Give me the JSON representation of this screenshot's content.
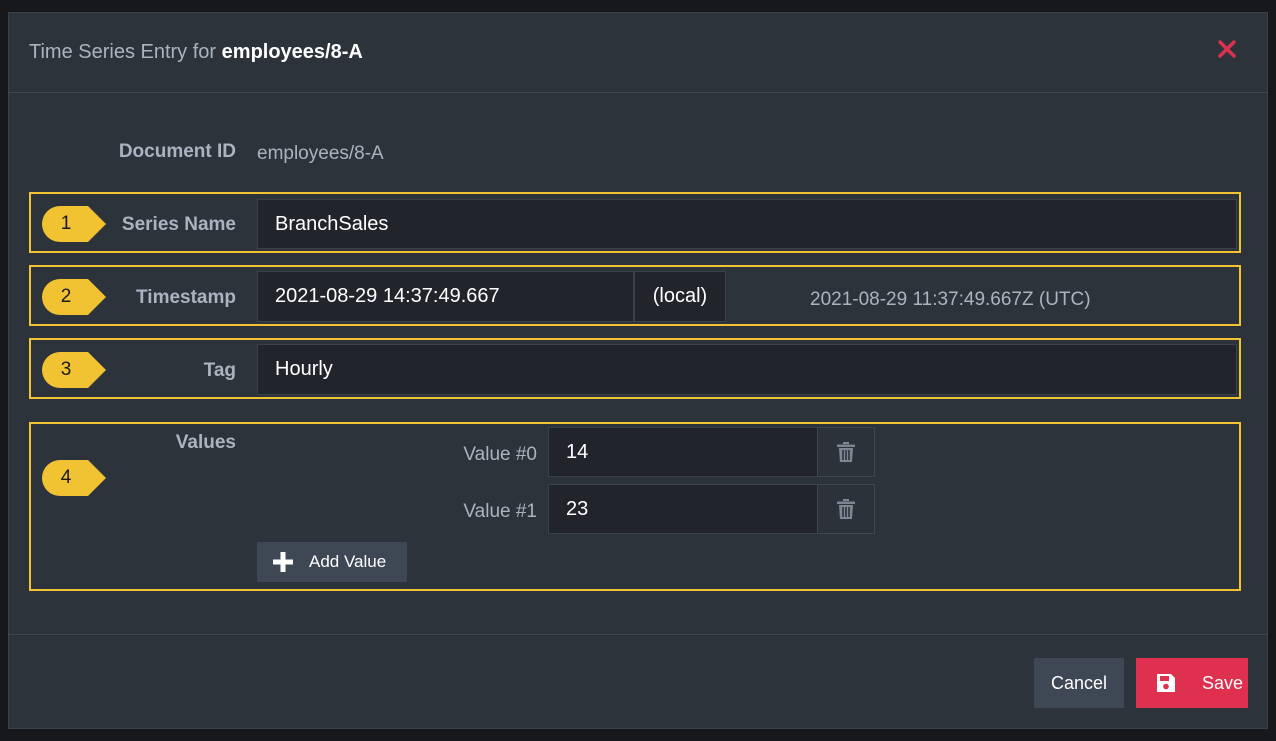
{
  "dialog": {
    "title_prefix": "Time Series Entry for",
    "title_document": "employees/8-A"
  },
  "form": {
    "document_id_label": "Document ID",
    "document_id_value": "employees/8-A",
    "series_name_label": "Series Name",
    "series_name_value": "BranchSales",
    "timestamp_label": "Timestamp",
    "timestamp_value": "2021-08-29 14:37:49.667",
    "timestamp_zone": "(local)",
    "timestamp_utc": "2021-08-29 11:37:49.667Z (UTC)",
    "tag_label": "Tag",
    "tag_value": "Hourly",
    "values_label": "Values",
    "values": [
      {
        "label": "Value #0",
        "value": "14"
      },
      {
        "label": "Value #1",
        "value": "23"
      }
    ],
    "add_value_label": "Add Value"
  },
  "markers": [
    "1",
    "2",
    "3",
    "4"
  ],
  "footer": {
    "cancel_label": "Cancel",
    "save_label": "Save"
  },
  "colors": {
    "highlight": "#f1c232",
    "save": "#e0304f",
    "close": "#e0304f"
  }
}
